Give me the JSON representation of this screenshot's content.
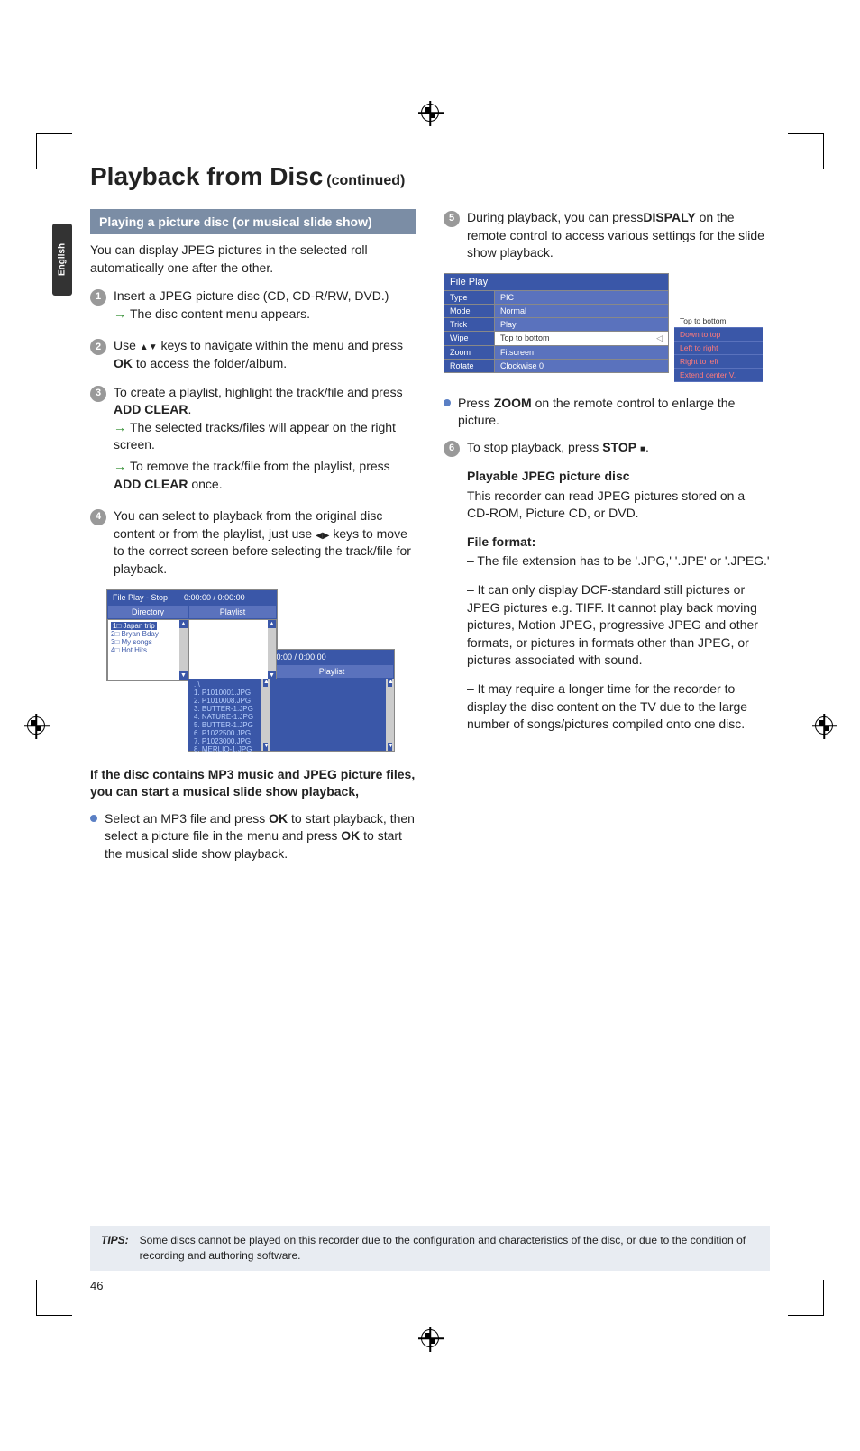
{
  "title": {
    "main": "Playback from Disc",
    "cont": "(continued)"
  },
  "sideTab": "English",
  "section": {
    "heading": "Playing a picture disc (or musical slide show)"
  },
  "intro": "You can display JPEG pictures in the selected roll automatically one after the other.",
  "steps": {
    "s1": {
      "text": "Insert a JPEG picture disc (CD, CD-R/RW, DVD.)",
      "arrow1": "The disc content menu appears."
    },
    "s2": {
      "pre": "Use ",
      "mid": " keys to navigate within the menu and press ",
      "ok": "OK",
      "post": " to access the folder/album."
    },
    "s3": {
      "line1a": "To create a playlist, highlight the track/file and press ",
      "ac": "ADD CLEAR",
      "line1b": ".",
      "arrow1": "The selected tracks/files will appear on the right screen.",
      "arrow2a": "To remove the track/file from the playlist, press ",
      "arrow2b": " once."
    },
    "s4": {
      "pre": "You can select to playback from the original disc content or from the playlist, just use ",
      "post": " keys to move to the correct screen before selecting the track/file for playback."
    },
    "s5": {
      "pre": "During playback, you can press",
      "disp": "DISPALY",
      "post": " on the remote control to access various settings for the slide show playback."
    },
    "s6": {
      "pre": "To stop playback, press ",
      "stop": "STOP",
      "post": "."
    }
  },
  "musical": {
    "heading": "If the disc contains MP3 music and JPEG picture files, you can start a musical slide show playback,",
    "bullet1a": "Select an MP3 file and press ",
    "ok": "OK",
    "bullet1b": " to start playback, then select a picture file in the menu and press ",
    "bullet1c": " to start the musical slide show playback."
  },
  "zoom": {
    "pre": "Press ",
    "z": "ZOOM",
    "post": " on the remote control to enlarge the picture."
  },
  "playable": {
    "heading": "Playable JPEG picture disc",
    "body": "This recorder can read JPEG pictures stored on a CD-ROM, Picture CD, or DVD."
  },
  "format": {
    "heading": "File format:",
    "l1": "–   The file extension has to be '.JPG,' '.JPE' or '.JPEG.'",
    "l2": "–   It can only display DCF-standard still pictures or JPEG pictures e.g. TIFF. It cannot play back moving pictures, Motion JPEG, progressive JPEG and other formats, or pictures in formats other than JPEG, or pictures associated with sound.",
    "l3": "–   It may require a longer time for the recorder to display the disc content on the TV due to the large number of songs/pictures compiled onto one disc."
  },
  "ui1": {
    "head1": "File Play - Stop",
    "head2": "0:00:00 / 0:00:00",
    "dir": "Directory",
    "pl": "Playlist",
    "dirs": [
      "1□ Japan trip",
      "2□ Bryan Bday",
      "3□ My songs",
      "4□ Hot Hits"
    ],
    "files": [
      "..\\",
      "1.   P1010001.JPG",
      "2.   P1010008.JPG",
      "3.   BUTTER-1.JPG",
      "4.   NATURE-1.JPG",
      "5.   BUTTER-1.JPG",
      "6.   P1022500.JPG",
      "7.   P1023000.JPG",
      "8.   MERLIO-1.JPG"
    ]
  },
  "ui2": {
    "head": "File Play",
    "rows": [
      {
        "k": "Type",
        "v": "PIC"
      },
      {
        "k": "Mode",
        "v": "Normal"
      },
      {
        "k": "Trick",
        "v": "Play"
      },
      {
        "k": "Wipe",
        "v": "Top to bottom",
        "sel": true
      },
      {
        "k": "Zoom",
        "v": "Fitscreen"
      },
      {
        "k": "Rotate",
        "v": "Clockwise 0"
      }
    ],
    "submenu": [
      "Top to bottom",
      "Down to top",
      "Left to right",
      "Right to left",
      "Extend center V."
    ]
  },
  "tips": {
    "label": "TIPS:",
    "body": "Some discs cannot be played on this recorder due to the configuration and characteristics of the disc, or due to the condition of recording and authoring software."
  },
  "pageNum": "46"
}
